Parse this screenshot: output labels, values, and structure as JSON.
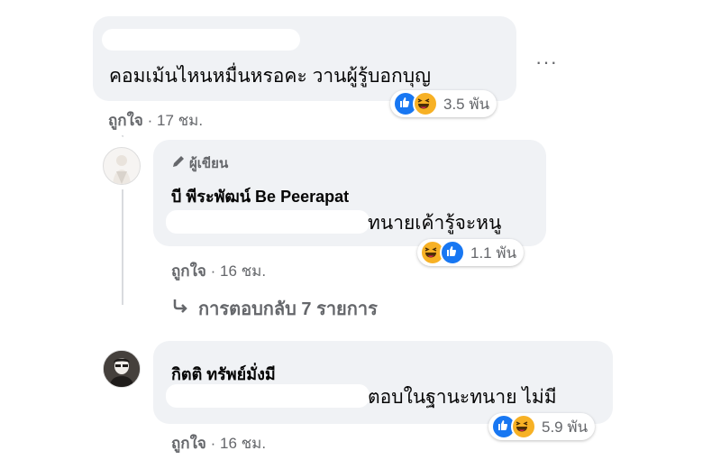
{
  "comments": [
    {
      "text": "คอมเม้นไหนหมื่นหรอคะ วานผู้รู้บอกบุญ",
      "reaction_count": "3.5 พัน",
      "like_label": "ถูกใจ",
      "time": "17 ชม."
    },
    {
      "author_badge": "ผู้เขียน",
      "author": "บี พีระพัฒน์ Be Peerapat",
      "text": "ทนายเค้ารู้จะหนู",
      "reaction_count": "1.1 พัน",
      "like_label": "ถูกใจ",
      "time": "16 ชม."
    },
    {
      "author": "กิตติ ทรัพย์มั่งมี",
      "text": "ตอบในฐานะทนาย ไม่มี",
      "reaction_count": "5.9 พัน",
      "like_label": "ถูกใจ",
      "time": "16 ชม."
    }
  ],
  "replies_link": "การตอบกลับ 7 รายการ",
  "more_menu_glyph": "···",
  "dot_separator": "·",
  "colors": {
    "bubble": "#f0f2f5",
    "like": "#1877f2",
    "haha": "#f7b125",
    "meta": "#65676b"
  },
  "icons": [
    "more-options-icon",
    "pencil-icon",
    "reply-arrow-icon",
    "like-reaction-icon",
    "haha-reaction-icon"
  ]
}
